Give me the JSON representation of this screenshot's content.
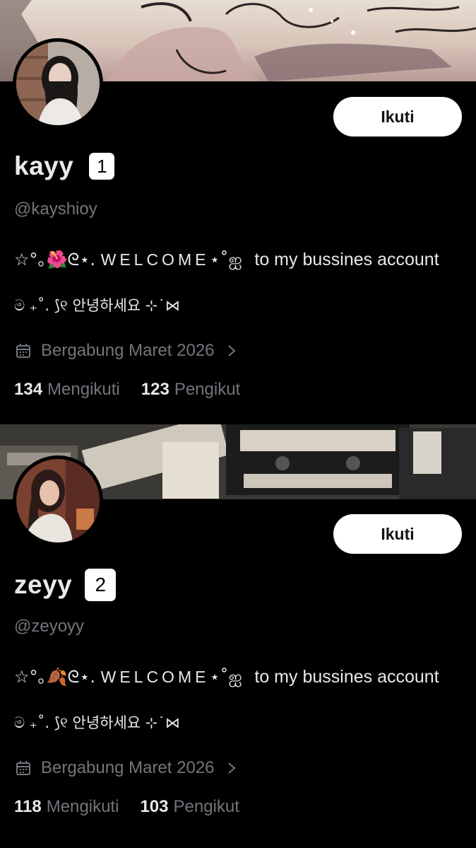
{
  "profiles": [
    {
      "number": "1",
      "name": "kayy",
      "handle": "@kayshioy",
      "follow_label": "Ikuti",
      "bio_line1_prefix": "☆°｡🌺",
      "bio_line1_mid": "ᘓ⋆.",
      "bio_line1_welcome": "WELCOME",
      "bio_line1_suffix": "⋆˚ஐ",
      "bio_line1_tail": "to my bussines account",
      "bio_line2": "ම ₊˚. ⟆୧ 안녕하세요 ⊹˙⋈",
      "joined": "Bergabung Maret 2026",
      "following_count": "134",
      "following_label": "Mengikuti",
      "followers_count": "123",
      "followers_label": "Pengikut",
      "icons": {
        "calendar": "calendar-icon",
        "chevron": "chevron-right-icon"
      }
    },
    {
      "number": "2",
      "name": "zeyy",
      "handle": "@zeyoyy",
      "follow_label": "Ikuti",
      "bio_line1_prefix": "☆°｡🍂",
      "bio_line1_mid": "ᘓ⋆.",
      "bio_line1_welcome": "WELCOME",
      "bio_line1_suffix": "⋆˚ஐ",
      "bio_line1_tail": "to my bussines account",
      "bio_line2": "ම ₊˚. ⟆୧ 안녕하세요 ⊹˙⋈",
      "joined": "Bergabung Maret 2026",
      "following_count": "118",
      "following_label": "Mengikuti",
      "followers_count": "103",
      "followers_label": "Pengikut",
      "icons": {
        "calendar": "calendar-icon",
        "chevron": "chevron-right-icon"
      }
    }
  ],
  "colors": {
    "background": "#000000",
    "primary_text": "#e7e9ea",
    "secondary_text": "#71767b",
    "button_bg": "#ffffff",
    "button_text": "#0f1419"
  }
}
